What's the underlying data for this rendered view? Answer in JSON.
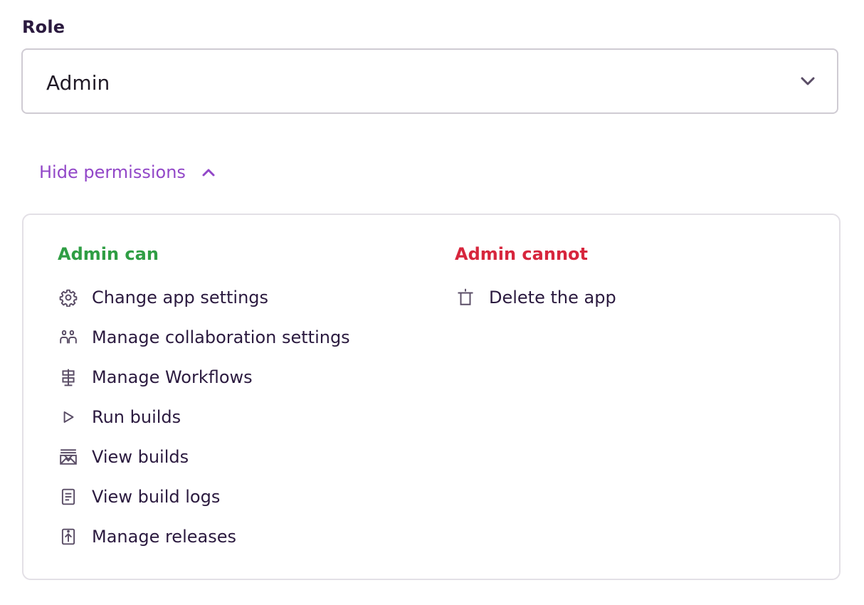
{
  "role": {
    "label": "Role",
    "selected": "Admin"
  },
  "permissions_toggle": {
    "label": "Hide permissions",
    "icon": "chevron-up-icon"
  },
  "permissions": {
    "can": {
      "title": "Admin can",
      "color": "#2f9e44",
      "items": [
        {
          "label": "Change app settings",
          "icon": "gear-icon"
        },
        {
          "label": "Manage collaboration settings",
          "icon": "people-icon"
        },
        {
          "label": "Manage Workflows",
          "icon": "workflow-icon"
        },
        {
          "label": "Run builds",
          "icon": "play-icon"
        },
        {
          "label": "View builds",
          "icon": "builds-icon"
        },
        {
          "label": "View build logs",
          "icon": "document-icon"
        },
        {
          "label": "Manage releases",
          "icon": "release-icon"
        }
      ]
    },
    "cannot": {
      "title": "Admin cannot",
      "color": "#d7263d",
      "items": [
        {
          "label": "Delete the app",
          "icon": "trash-icon"
        }
      ]
    }
  },
  "colors": {
    "accent": "#9247c8",
    "text": "#2b1a3f",
    "border": "#cfcbd3"
  }
}
